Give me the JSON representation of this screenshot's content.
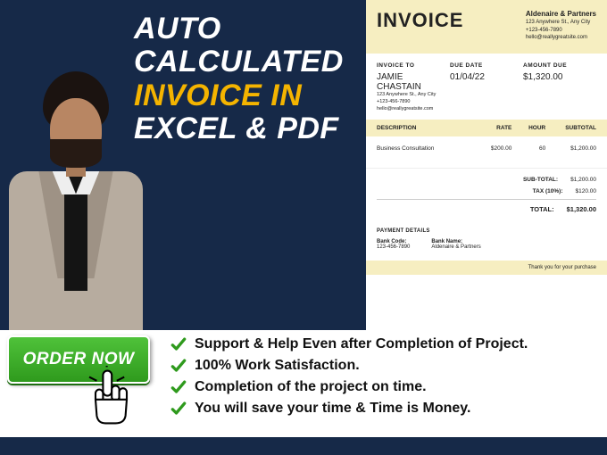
{
  "headline": {
    "l1": "AUTO",
    "l2": "CALCULATED",
    "l3": "INVOICE IN",
    "l4": "EXCEL & PDF"
  },
  "invoice": {
    "title": "INVOICE",
    "company": {
      "name": "Aldenaire & Partners",
      "addr": "123 Anywhere St., Any City",
      "phone": "+123-456-7890",
      "email": "hello@reallygreatsite.com"
    },
    "to_label": "INVOICE TO",
    "due_label": "DUE DATE",
    "amount_label": "AMOUNT DUE",
    "to": {
      "name": "JAMIE CHASTAIN",
      "addr": "123 Anywhere St., Any City",
      "phone": "+123-456-7890",
      "email": "hello@reallygreatsite.com"
    },
    "due_date": "01/04/22",
    "amount_due": "$1,320.00",
    "cols": {
      "desc": "DESCRIPTION",
      "rate": "RATE",
      "hour": "HOUR",
      "sub": "SUBTOTAL"
    },
    "rows": [
      {
        "desc": "Business Consultation",
        "rate": "$200.00",
        "hour": "60",
        "sub": "$1,200.00"
      }
    ],
    "totals": {
      "sub_label": "SUB-TOTAL:",
      "sub": "$1,200.00",
      "tax_label": "TAX (10%):",
      "tax": "$120.00",
      "total_label": "TOTAL:",
      "total": "$1,320.00"
    },
    "payment": {
      "title": "PAYMENT DETAILS",
      "code_label": "Bank Code:",
      "code": "123-456-7890",
      "name_label": "Bank Name:",
      "name": "Aldenaire & Partners"
    },
    "thanks": "Thank you for your purchase"
  },
  "order_label": "ORDER NOW",
  "features": [
    "Support & Help Even after Completion of Project.",
    "100% Work Satisfaction.",
    " Completion of the project on time.",
    "You will save your time & Time is Money."
  ]
}
